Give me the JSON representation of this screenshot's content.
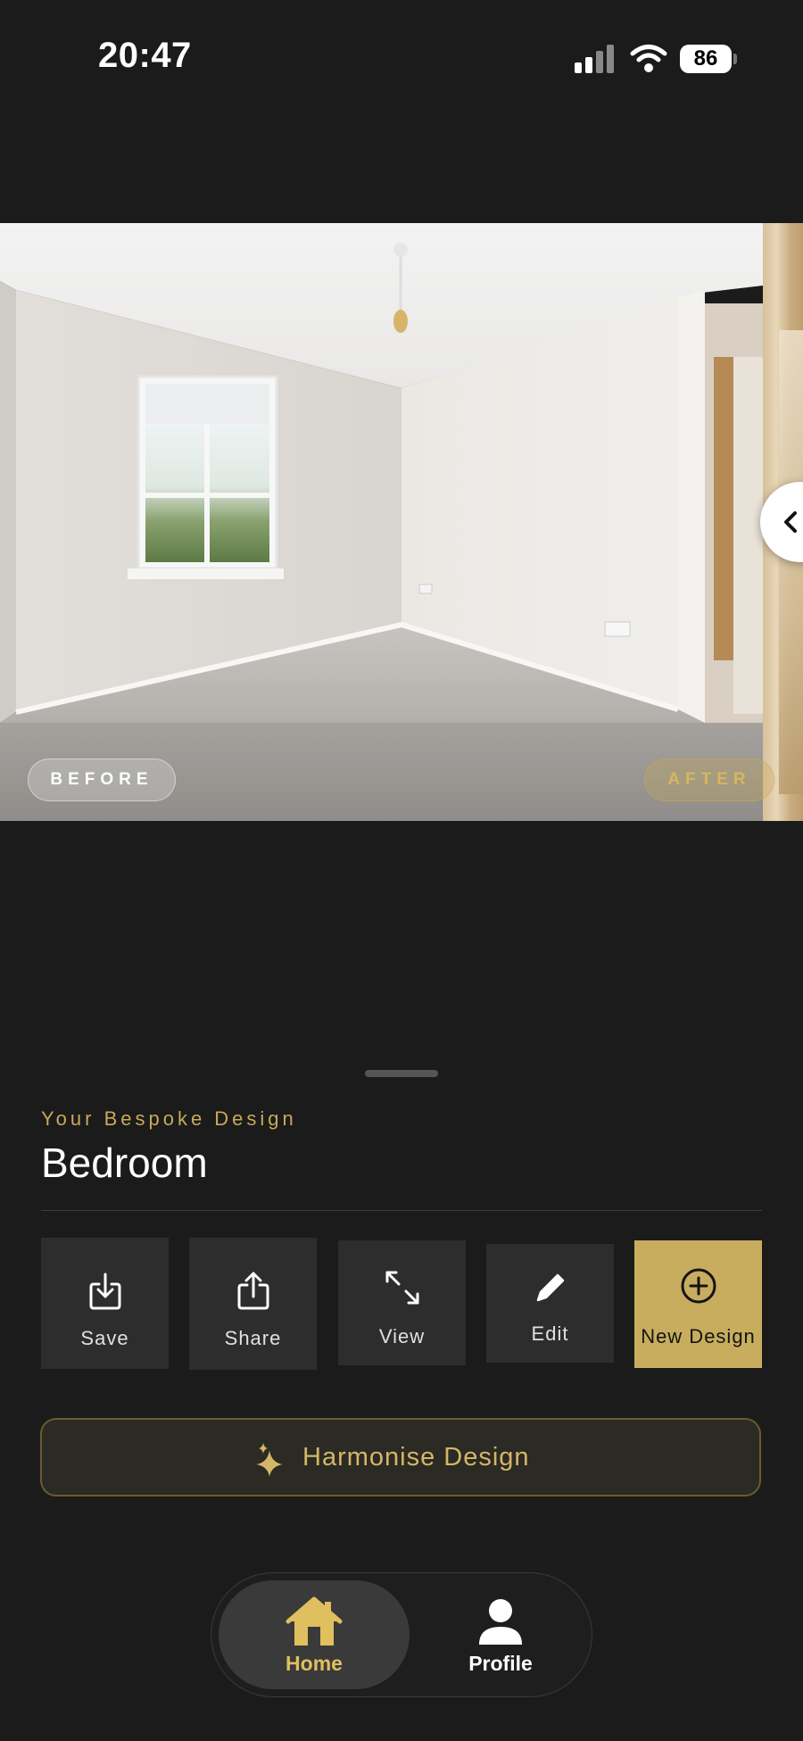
{
  "status_bar": {
    "time": "20:47",
    "battery": "86"
  },
  "compare": {
    "before_label": "BEFORE",
    "after_label": "AFTER"
  },
  "design": {
    "eyebrow": "Your Bespoke Design",
    "title": "Bedroom"
  },
  "actions": [
    {
      "label": "Save",
      "icon": "download-icon"
    },
    {
      "label": "Share",
      "icon": "share-icon"
    },
    {
      "label": "View",
      "icon": "expand-icon"
    },
    {
      "label": "Edit",
      "icon": "pencil-icon"
    },
    {
      "label": "New Design",
      "icon": "plus-circle-icon"
    }
  ],
  "harmonise": {
    "label": "Harmonise Design",
    "icon": "sparkle-icon"
  },
  "tabs": [
    {
      "label": "Home",
      "icon": "house-icon",
      "active": true
    },
    {
      "label": "Profile",
      "icon": "person-icon",
      "active": false
    }
  ],
  "colors": {
    "accent": "#c8ad5e",
    "background": "#1b1b1b",
    "tile": "#2d2d2d"
  }
}
